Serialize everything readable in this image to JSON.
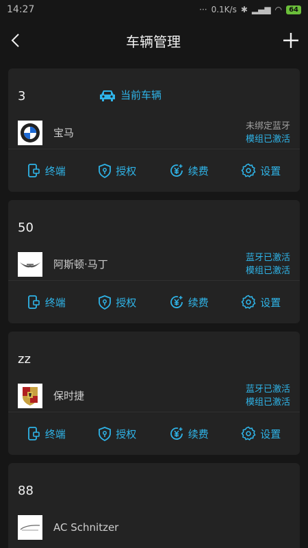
{
  "status_bar": {
    "time": "14:27",
    "dots": "···",
    "speed": "0.1K/s",
    "battery": "64"
  },
  "header": {
    "title": "车辆管理"
  },
  "vehicles": [
    {
      "number": "3",
      "current_label": "当前车辆",
      "brand": "宝马",
      "status": [
        "未绑定蓝牙",
        "模组已激活"
      ]
    },
    {
      "number": "50",
      "brand": "阿斯顿·马丁",
      "status": [
        "蓝牙已激活",
        "模组已激活"
      ]
    },
    {
      "number": "zz",
      "brand": "保时捷",
      "status": [
        "蓝牙已激活",
        "模组已激活"
      ]
    },
    {
      "number": "88",
      "brand": "AC Schnitzer"
    }
  ],
  "actions": {
    "terminal": "终端",
    "authorize": "授权",
    "renew": "续费",
    "settings": "设置"
  },
  "colors": {
    "accent": "#2fb4e8",
    "card": "#232323",
    "background": "#161616"
  }
}
